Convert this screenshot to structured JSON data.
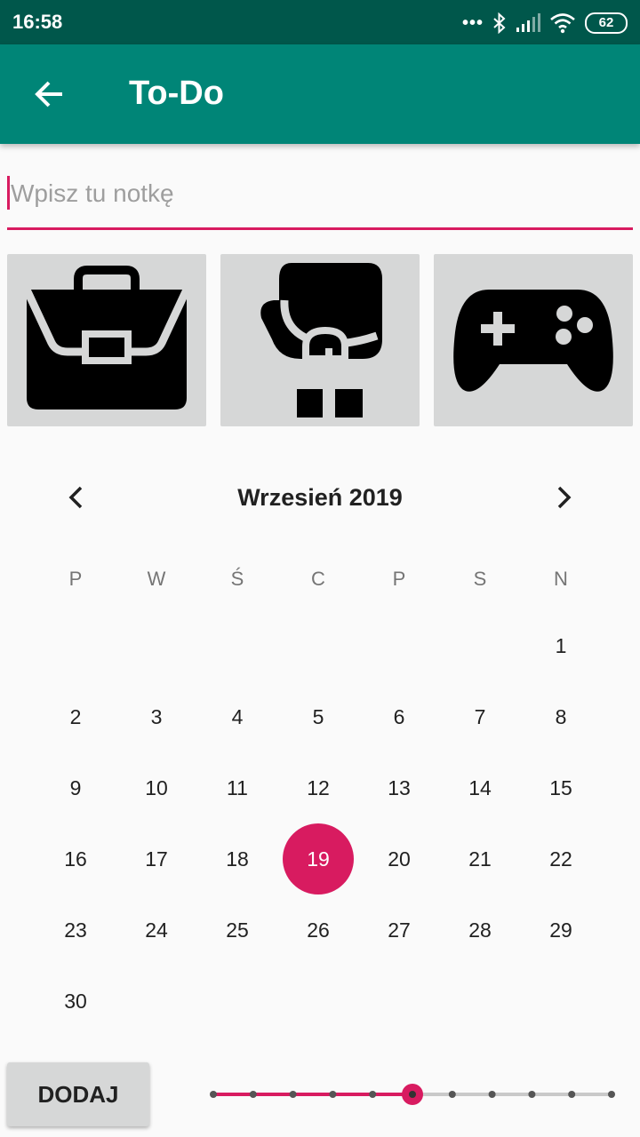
{
  "status_bar": {
    "time": "16:58",
    "battery": "62",
    "dots": "•••"
  },
  "app_bar": {
    "title": "To-Do",
    "back_icon": "arrow-back-icon"
  },
  "note": {
    "placeholder": "Wpisz tu notkę",
    "value": ""
  },
  "categories": [
    {
      "icon": "briefcase-icon"
    },
    {
      "icon": "boxing-glove-icon"
    },
    {
      "icon": "gamepad-icon"
    }
  ],
  "calendar": {
    "month_label": "Wrzesień 2019",
    "weekdays": [
      "P",
      "W",
      "Ś",
      "C",
      "P",
      "S",
      "N"
    ],
    "first_weekday_index": 6,
    "days_in_month": 30,
    "selected_day": 19
  },
  "add_button": {
    "label": "DODAJ"
  },
  "slider": {
    "steps": 11,
    "value_index": 5
  },
  "colors": {
    "accent": "#d81b60",
    "primary": "#008577",
    "primary_dark": "#00574b"
  }
}
